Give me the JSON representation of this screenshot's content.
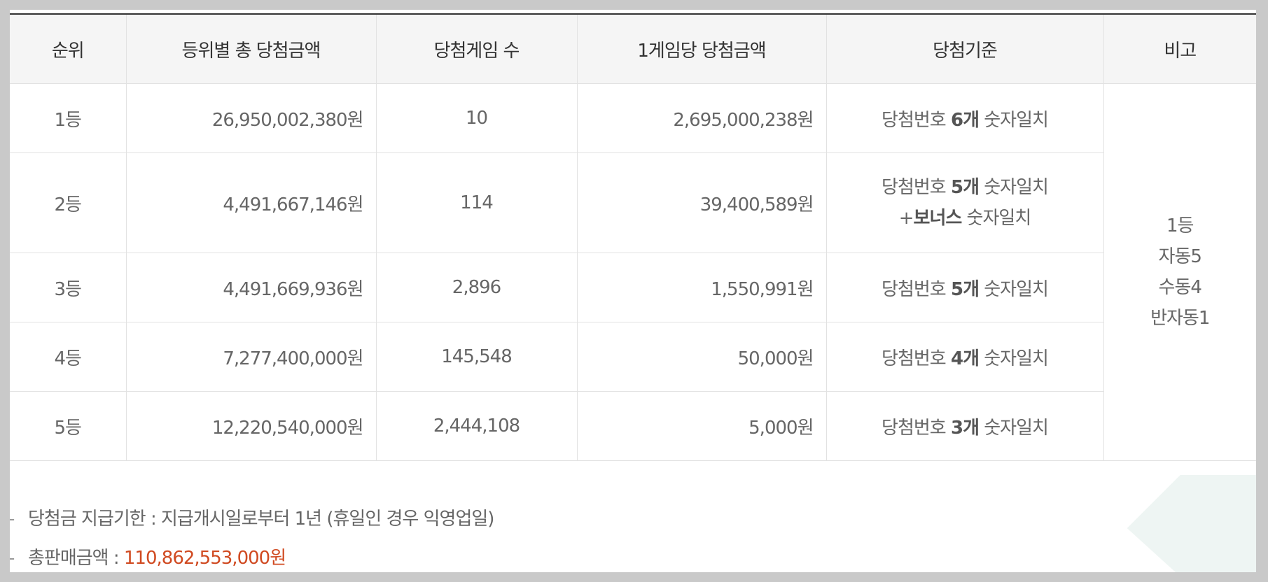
{
  "headers": [
    "순위",
    "등위별 총 당첨금액",
    "당첨게임 수",
    "1게임당 당첨금액",
    "당첨기준",
    "비고"
  ],
  "rows": [
    {
      "rank": "1등",
      "total": "26,950,002,380원",
      "games": "10",
      "per_game": "2,695,000,238원",
      "criteria": {
        "prefix": "당첨번호 ",
        "count": "6개",
        "suffix": " 숫자일치",
        "bonus_plus": "",
        "bonus_bold": "",
        "bonus_suffix": ""
      }
    },
    {
      "rank": "2등",
      "total": "4,491,667,146원",
      "games": "114",
      "per_game": "39,400,589원",
      "criteria": {
        "prefix": "당첨번호 ",
        "count": "5개",
        "suffix": " 숫자일치",
        "bonus_plus": "+",
        "bonus_bold": "보너스",
        "bonus_suffix": " 숫자일치"
      }
    },
    {
      "rank": "3등",
      "total": "4,491,669,936원",
      "games": "2,896",
      "per_game": "1,550,991원",
      "criteria": {
        "prefix": "당첨번호 ",
        "count": "5개",
        "suffix": " 숫자일치"
      }
    },
    {
      "rank": "4등",
      "total": "7,277,400,000원",
      "games": "145,548",
      "per_game": "50,000원",
      "criteria": {
        "prefix": "당첨번호 ",
        "count": "4개",
        "suffix": " 숫자일치"
      }
    },
    {
      "rank": "5등",
      "total": "12,220,540,000원",
      "games": "2,444,108",
      "per_game": "5,000원",
      "criteria": {
        "prefix": "당첨번호 ",
        "count": "3개",
        "suffix": " 숫자일치"
      }
    }
  ],
  "remarks": [
    "1등",
    "자동5",
    "수동4",
    "반자동1"
  ],
  "notes": {
    "dash": "-",
    "deadline": "당첨금 지급기한 : 지급개시일로부터 1년 (휴일인 경우 익영업일)",
    "sales_label": "총판매금액 : ",
    "sales_value": "110,862,553,000원"
  },
  "colors": {
    "accent_red": "#d04a21",
    "header_bg": "#f5f5f5",
    "border": "#e2e2e2"
  }
}
